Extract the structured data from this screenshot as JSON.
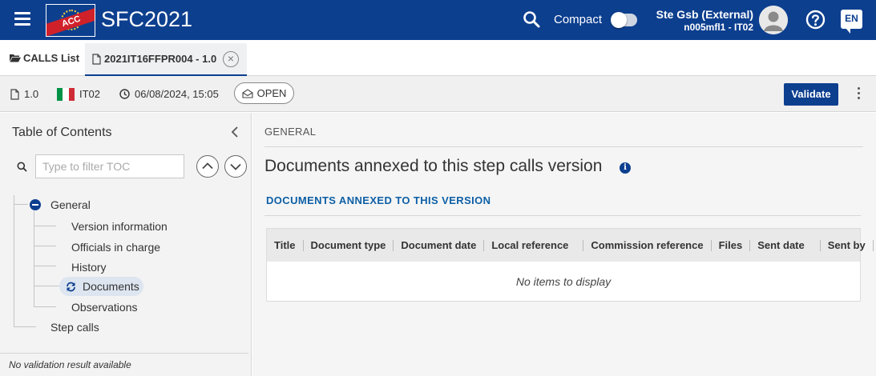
{
  "colors": {
    "primary": "#0d3f8f",
    "accent_text": "#0d5fa6",
    "logo_band": "#d0212a"
  },
  "header": {
    "logo_text": "ACC",
    "app_title": "SFC2021",
    "compact_label": "Compact",
    "compact_enabled": false,
    "user_name": "Ste Gsb (External)",
    "user_sub": "n005mfl1 - IT02",
    "language": "EN",
    "icons": [
      "menu-icon",
      "search-icon",
      "user-avatar",
      "help-icon",
      "language-icon"
    ]
  },
  "tabs": {
    "calls_list": "CALLS List",
    "active_doc": "2021IT16FFPR004 - 1.0"
  },
  "infobar": {
    "version": "1.0",
    "country": "IT02",
    "flag_colors": [
      "#009246",
      "#ffffff",
      "#ce2b37"
    ],
    "datetime": "06/08/2024, 15:05",
    "status": "OPEN",
    "validate_label": "Validate"
  },
  "toc": {
    "title": "Table of Contents",
    "filter_placeholder": "Type to filter TOC",
    "root": "General",
    "children": [
      "Version information",
      "Officials in charge",
      "History",
      "Documents",
      "Observations"
    ],
    "selected": "Documents",
    "sibling": "Step calls",
    "status": "No validation result available"
  },
  "main": {
    "section_label": "GENERAL",
    "heading": "Documents annexed to this step calls version",
    "sub_heading": "DOCUMENTS ANNEXED TO THIS VERSION",
    "columns": [
      "Title",
      "Document type",
      "Document date",
      "Local reference",
      "Commission reference",
      "Files",
      "Sent date",
      "Sent by"
    ],
    "empty_text": "No items to display"
  }
}
